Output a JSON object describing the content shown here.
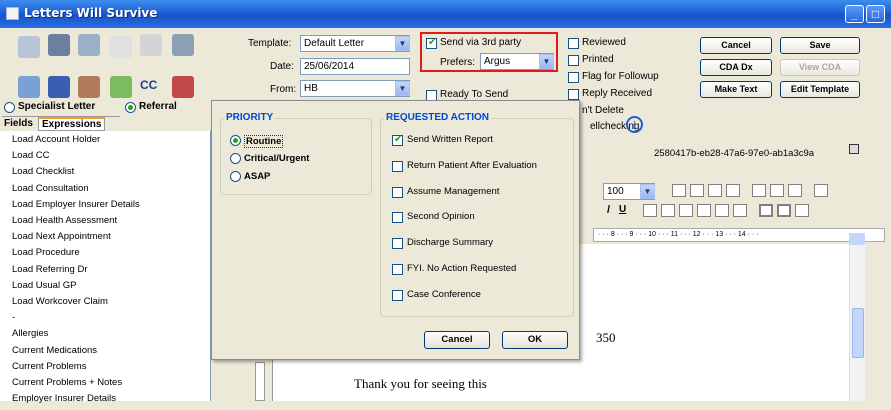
{
  "window": {
    "title": "Letters Will Survive"
  },
  "toolbar": {
    "template_label": "Template:",
    "template_value": "Default Letter",
    "date_label": "Date:",
    "date_value": "25/06/2014",
    "from_label": "From:",
    "from_value": "HB",
    "send_3rd_party": "Send via 3rd party",
    "prefers_label": "Prefers:",
    "prefers_value": "Argus",
    "ready_to_send": "Ready To Send",
    "reviewed": "Reviewed",
    "printed": "Printed",
    "flag_followup": "Flag for Followup",
    "reply_received": "Reply Received",
    "dont_delete": "n't Delete",
    "spellchecking": "ellchecking",
    "cancel": "Cancel",
    "save": "Save",
    "cda_dx": "CDA Dx",
    "view_cda": "View CDA",
    "make_text": "Make Text",
    "edit_template": "Edit Template",
    "guid": "2580417b-eb28-47a6-97e0-ab1a3c9a",
    "cc_label": "CC"
  },
  "left": {
    "specialist_letter": "Specialist Letter",
    "referral": "Referral",
    "tab_fields": "Fields",
    "tab_expressions": "Expressions",
    "items": [
      "Load Account Holder",
      "Load CC",
      "Load Checklist",
      "Load Consultation",
      "Load Employer Insurer Details",
      "Load Health Assessment",
      "Load Next Appointment",
      "Load Procedure",
      "Load Referring Dr",
      "Load Usual GP",
      "Load Workcover Claim",
      "-",
      "Allergies",
      "Current Medications",
      "Current Problems",
      "Current Problems + Notes",
      "Employer Insurer Details"
    ]
  },
  "editor": {
    "zoom": "100",
    "ruler": "· · · 8 · · · 9 · · · 10 · · · 11 · · · 12 · · · 13 · · · 14 · · ·",
    "num_fragment": "350",
    "body_line": "Thank you for seeing this"
  },
  "dialog": {
    "priority_title": "PRIORITY",
    "priorities": [
      "Routine",
      "Critical/Urgent",
      "ASAP"
    ],
    "action_title": "REQUESTED ACTION",
    "actions": [
      "Send Written Report",
      "Return Patient After Evaluation",
      "Assume Management",
      "Second Opinion",
      "Discharge Summary",
      "FYI. No Action Requested",
      "Case Conference"
    ],
    "cancel": "Cancel",
    "ok": "OK"
  }
}
